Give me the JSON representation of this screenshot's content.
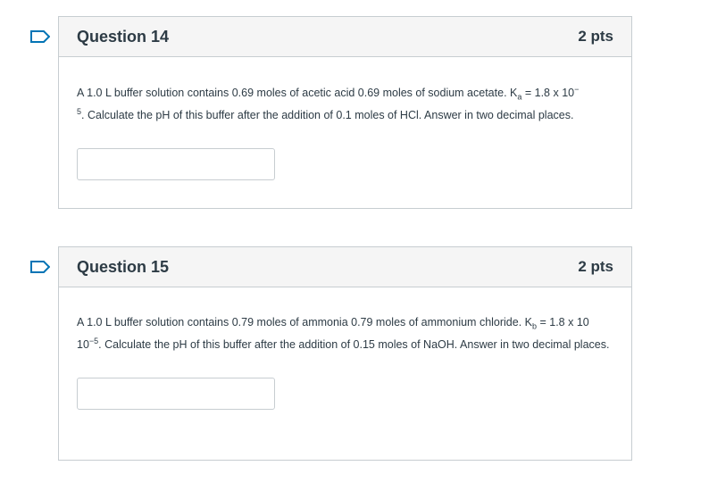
{
  "questions": [
    {
      "title": "Question 14",
      "points": "2 pts",
      "text": {
        "line1_pre": "A 1.0 L buffer solution contains 0.69 moles of acetic acid 0.69 moles of sodium acetate.  K",
        "const_sub": "a",
        "line1_post": " = 1.8 x 10",
        "exp_dash": "−",
        "exp_value": "5",
        "rest": ". Calculate the pH of this buffer after the addition of 0.1 moles of HCl. Answer in two decimal places."
      },
      "answer_value": ""
    },
    {
      "title": "Question 15",
      "points": "2 pts",
      "text": {
        "line1_pre": "A 1.0 L buffer solution contains 0.79 moles of ammonia 0.79 moles of ammonium chloride.  K",
        "const_sub": "b",
        "line1_post": " = 1.8 x 10",
        "exp_value": "−5",
        "rest": ". Calculate the pH of this buffer after the addition of 0.15 moles of NaOH. Answer in two decimal places."
      },
      "answer_value": ""
    }
  ],
  "colors": {
    "flag_stroke": "#0374b5",
    "header_bg": "#f5f5f5",
    "border": "#c7cdd1",
    "text": "#2d3b45"
  }
}
